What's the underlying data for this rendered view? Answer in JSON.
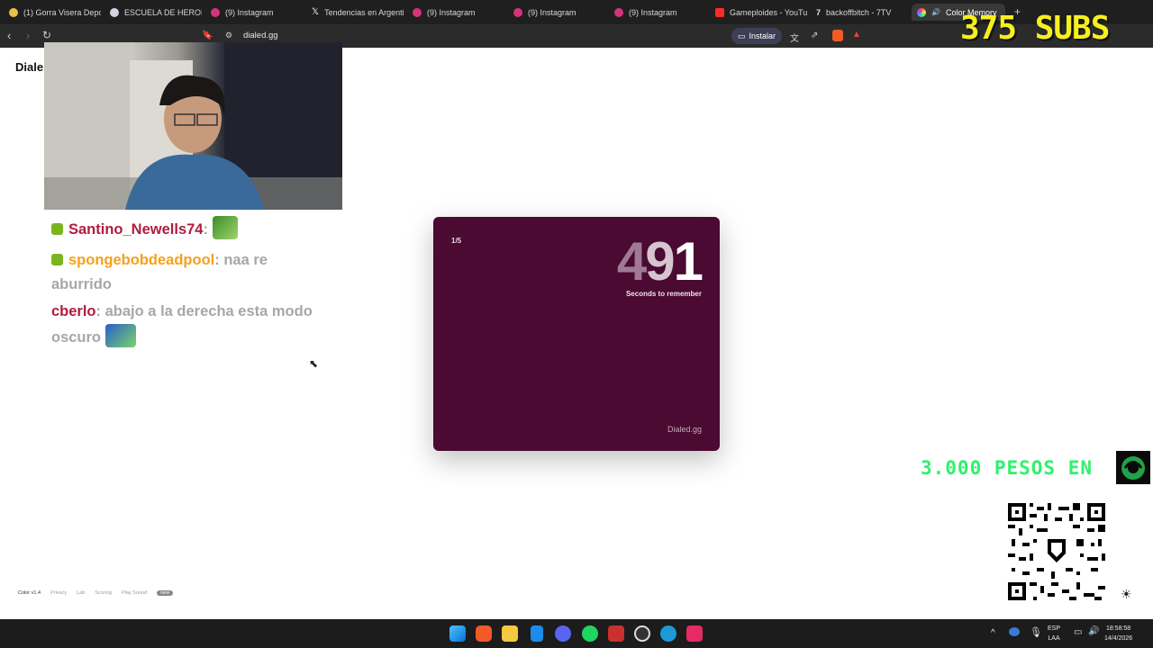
{
  "browser": {
    "tabs": [
      {
        "title": "(1) Gorra Visera Depo",
        "color": "#e8c04a"
      },
      {
        "title": "ESCUELA DE HEROES",
        "color": "#cfd5dc"
      },
      {
        "title": "(9) Instagram",
        "color": "#d6337f"
      },
      {
        "title": "Tendencias en Argenti",
        "color": "#ffffff"
      },
      {
        "title": "(9) Instagram",
        "color": "#d6337f"
      },
      {
        "title": "(9) Instagram",
        "color": "#d6337f"
      },
      {
        "title": "(9) Instagram",
        "color": "#d6337f"
      },
      {
        "title": "Gameploides - YouTu",
        "color": "#ff2b2b"
      },
      {
        "title": "backoffbitch - 7TV",
        "color": "#e6e6e6"
      },
      {
        "title": "Color Memory",
        "color": "#6aa6ff",
        "active": true
      }
    ],
    "url": "dialed.gg",
    "install_label": "Instalar"
  },
  "overlay": {
    "subs": "375 SUBS",
    "promo": "3.000 PESOS EN"
  },
  "page": {
    "logo": "Diale",
    "game": {
      "round": "1/5",
      "countdown_fade": "4",
      "countdown_mid": "9",
      "countdown_main": "1",
      "countdown_label": "Seconds to remember",
      "brand": "Dialed.gg",
      "card_color": "#4a0a31"
    },
    "footer": {
      "version": "Color v1.4",
      "links": [
        "Privacy",
        "Lab",
        "Scoring",
        "Play Sound"
      ],
      "tag": "new"
    }
  },
  "chat": {
    "messages": [
      {
        "user": "Santino_Newells74",
        "text": ""
      },
      {
        "user": "spongebobdeadpool",
        "text": "naa re aburrido"
      },
      {
        "user": "cberlo",
        "text": "abajo a la derecha esta modo oscuro"
      }
    ]
  },
  "taskbar": {
    "lang_top": "ESP",
    "lang_bottom": "LAA",
    "time": "18:58:58",
    "date": "14/4/2026"
  }
}
